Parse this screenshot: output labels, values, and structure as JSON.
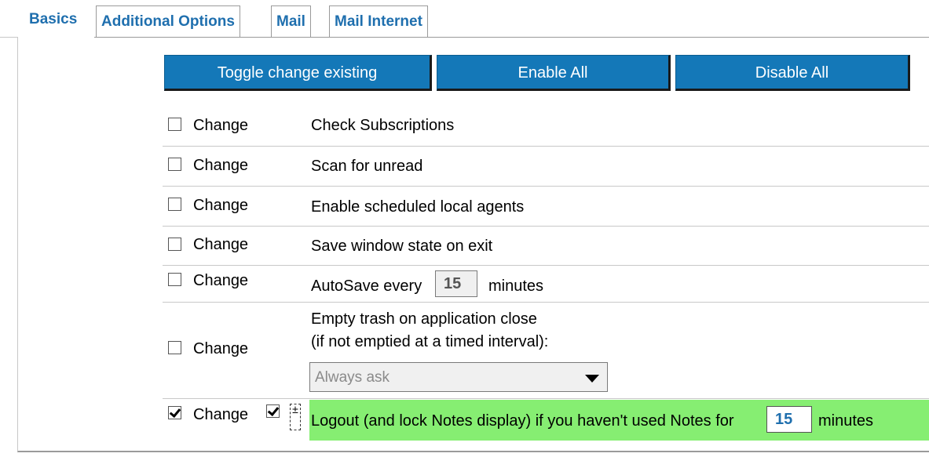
{
  "tabs": [
    {
      "label": "Basics",
      "active": true
    },
    {
      "label": "Additional Options",
      "active": false
    },
    {
      "label": "Mail",
      "active": false
    },
    {
      "label": "Mail Internet",
      "active": false
    }
  ],
  "buttons": {
    "toggle": "Toggle change existing",
    "enable_all": "Enable All",
    "disable_all": "Disable All"
  },
  "change_label": "Change",
  "rows": [
    {
      "text": "Check Subscriptions",
      "checked": false
    },
    {
      "text": "Scan for unread",
      "checked": false
    },
    {
      "text": "Enable scheduled local agents",
      "checked": false
    },
    {
      "text": "Save window state on exit",
      "checked": false
    },
    {
      "text_before": "AutoSave every",
      "value": "15",
      "text_after": "minutes",
      "checked": false
    },
    {
      "text_line1": "Empty trash on application close",
      "text_line2": "(if not emptied at a timed interval):",
      "select_value": "Always ask",
      "checked": false
    },
    {
      "text_before": "Logout (and lock Notes display) if you haven't used Notes for",
      "value": "15",
      "text_after": "minutes",
      "checked": true,
      "enabled_checked": true
    }
  ],
  "colors": {
    "tab_text": "#1f6fae",
    "button_bg": "#1478b8",
    "highlight_green": "#86ee72"
  },
  "icons": {
    "expand": "plus-minus-icon"
  }
}
